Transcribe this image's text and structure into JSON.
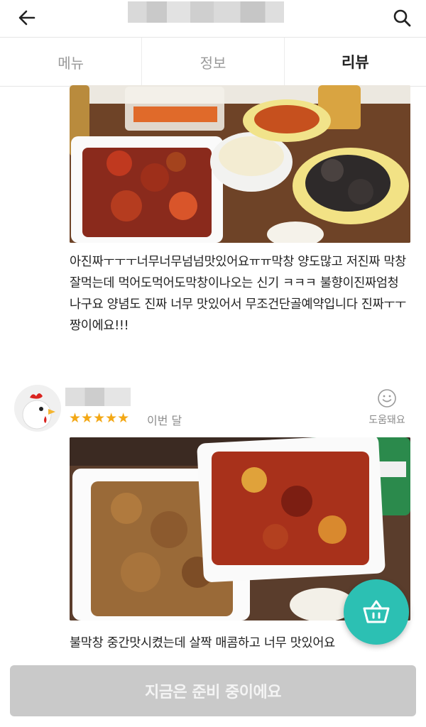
{
  "header": {
    "back_icon": "arrow-left-icon",
    "search_icon": "search-icon"
  },
  "tabs": [
    {
      "label": "메뉴",
      "active": false
    },
    {
      "label": "정보",
      "active": false
    },
    {
      "label": "리뷰",
      "active": true
    }
  ],
  "reviews": [
    {
      "text": "아진짜ㅜㅜㅜ너무너무넘넘맛있어요ㅠㅠ막창 양도많고 저진짜 막창잘먹는데 먹어도먹어도막창이나오는 신기 ㅋㅋㅋ 불향이진짜엄청나구요 양념도 진짜 너무 맛있어서 무조건단골예약입니다 진짜ㅜㅜ짱이에요!!!"
    },
    {
      "stars": "★★★★★",
      "rating": 5,
      "date": "이번 달",
      "helpful_label": "도움돼요",
      "text": "불막창 중간맛시켰는데 살짝 매콤하고 너무 맛있어요"
    }
  ],
  "cart_icon": "basket-icon",
  "order_button": {
    "label": "지금은 준비 중이에요"
  },
  "colors": {
    "accent": "#2cc0b3",
    "star": "#f3a816",
    "disabled_button": "#c9c9c9"
  }
}
